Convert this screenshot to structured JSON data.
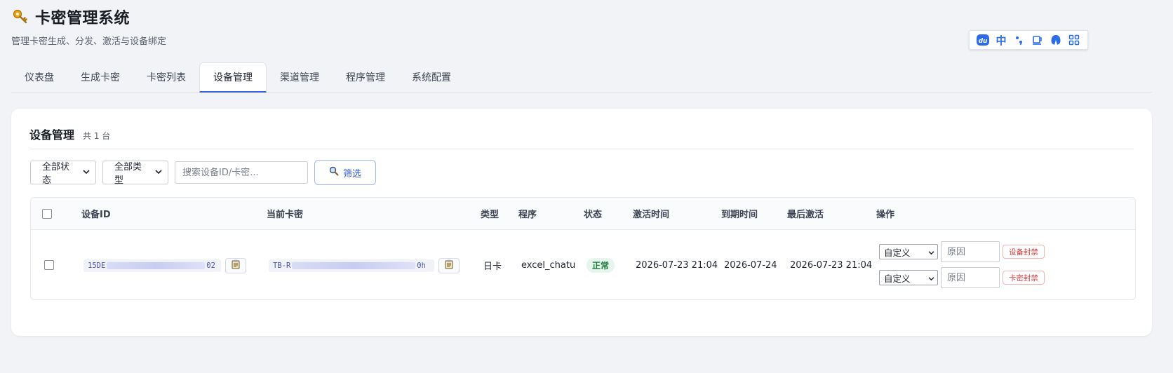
{
  "app": {
    "title": "卡密管理系统",
    "subtitle": "管理卡密生成、分发、激活与设备绑定"
  },
  "tabs": [
    {
      "label": "仪表盘"
    },
    {
      "label": "生成卡密"
    },
    {
      "label": "卡密列表"
    },
    {
      "label": "设备管理"
    },
    {
      "label": "渠道管理"
    },
    {
      "label": "程序管理"
    },
    {
      "label": "系统配置"
    }
  ],
  "ime_toolbar": {
    "items": [
      "du-logo-icon",
      "中",
      "punctuation-icon",
      "cup-icon",
      "skin-icon",
      "grid-icon"
    ],
    "lang_label": "中"
  },
  "panel": {
    "title": "设备管理",
    "count": "共 1 台"
  },
  "filters": {
    "status_select": "全部状态",
    "type_select": "全部类型",
    "search_placeholder": "搜索设备ID/卡密...",
    "filter_button": "筛选"
  },
  "table": {
    "columns": [
      "设备ID",
      "当前卡密",
      "类型",
      "程序",
      "状态",
      "激活时间",
      "到期时间",
      "最后激活",
      "操作"
    ],
    "rows": [
      {
        "device_id_prefix": "15DE",
        "device_id_suffix": "02",
        "card_key_prefix": "TB-R",
        "card_key_suffix": "0h",
        "type": "日卡",
        "program": "excel_chatu",
        "status": "正常",
        "activated_at": "2026-07-23 21:04",
        "expires_at": "2026-07-24",
        "last_activated": "2026-07-23 21:04",
        "ban_reason_select": "自定义",
        "ban_reason_placeholder": "原因",
        "ban_device_label": "设备封禁",
        "ban_key_reason_select": "自定义",
        "ban_key_reason_placeholder": "原因",
        "ban_key_label": "卡密封禁"
      }
    ]
  },
  "colors": {
    "accent": "#3a63d8",
    "status_ok_bg": "#e6f6ec",
    "status_ok_text": "#1f7a3f",
    "danger": "#d93a3a"
  }
}
